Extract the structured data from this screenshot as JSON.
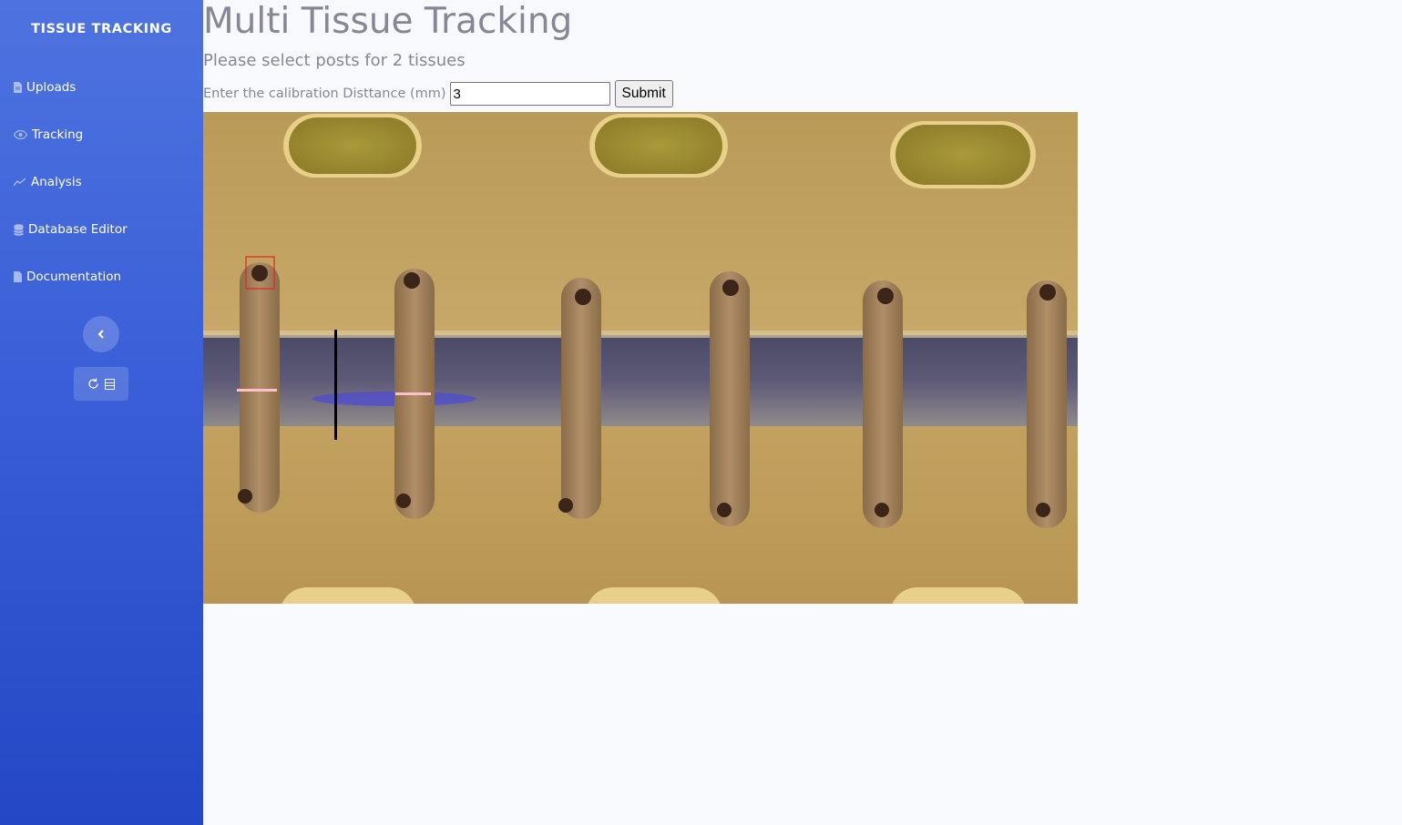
{
  "sidebar": {
    "brand": "TISSUE TRACKING",
    "items": [
      {
        "label": "Uploads",
        "icon": "file-icon"
      },
      {
        "label": "Tracking",
        "icon": "eye-icon"
      },
      {
        "label": "Analysis",
        "icon": "chart-line-icon"
      },
      {
        "label": "Database Editor",
        "icon": "database-icon"
      },
      {
        "label": "Documentation",
        "icon": "file-icon"
      }
    ],
    "toggle_icon": "chevron-left-icon",
    "extra_button_icons": [
      "refresh-icon",
      "list-icon"
    ],
    "gradient": [
      "#4e73df",
      "#224abe"
    ]
  },
  "main": {
    "title": "Multi Tissue Tracking",
    "subtitle": "Please select posts for 2 tissues",
    "calibration": {
      "label": "Enter the calibration Disttance (mm)",
      "value": "3"
    },
    "submit_label": "Submit"
  },
  "colors": {
    "text_muted": "#858796",
    "background": "#f8f9fc",
    "selection_box": "#e02424",
    "tissue_marker": "#ffc0cb",
    "calibration_line": "#000000"
  }
}
